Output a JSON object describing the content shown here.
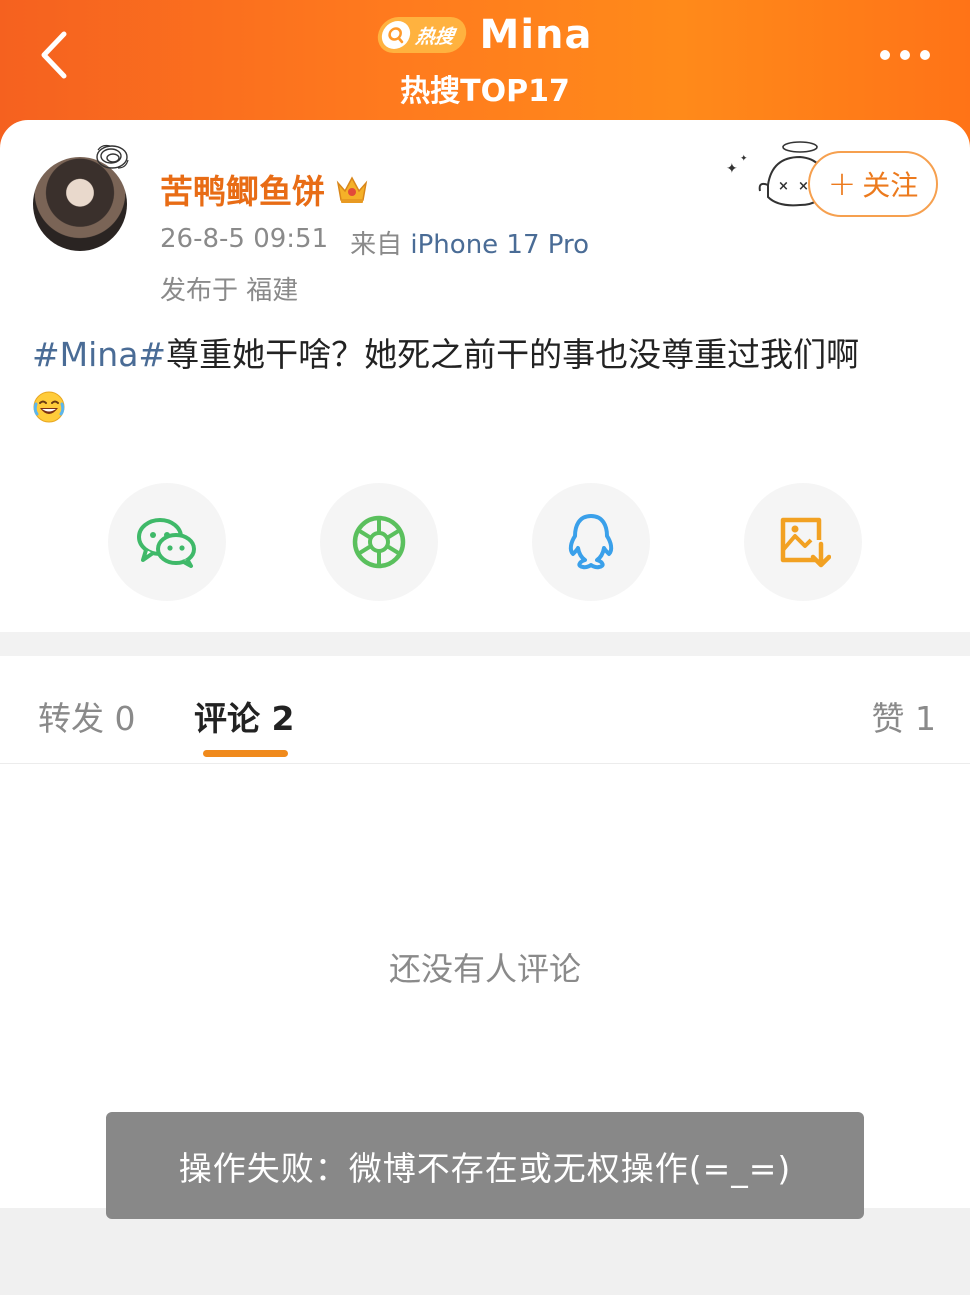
{
  "header": {
    "hot_label": "热搜",
    "topic": "Mina",
    "rank_label": "热搜TOP17"
  },
  "post": {
    "username": "苦鸭鲫鱼饼",
    "date": "26-8-5 09:51",
    "source_prefix": "来自",
    "device": "iPhone 17 Pro",
    "location": "发布于 福建",
    "follow_label": "关注",
    "hashtag": "#Mina#",
    "text": "尊重她干啥？她死之前干的事也没尊重过我们啊"
  },
  "share": [
    {
      "name": "wechat",
      "icon": "wechat-icon",
      "color": "#3fb969"
    },
    {
      "name": "moments",
      "icon": "moments-icon",
      "color": "#5ac05d"
    },
    {
      "name": "qq",
      "icon": "qq-icon",
      "color": "#3aa0ea"
    },
    {
      "name": "save-image",
      "icon": "save-image-icon",
      "color": "#f2a122"
    }
  ],
  "tabs": {
    "repost": "转发 0",
    "comment": "评论 2",
    "like": "赞 1"
  },
  "empty_text": "还没有人评论",
  "toast": "操作失败：微博不存在或无权操作(=_=)",
  "colors": {
    "header_orange": "#ff7a1e",
    "accent_orange": "#f08a1c",
    "link_blue": "#4a6c96"
  }
}
